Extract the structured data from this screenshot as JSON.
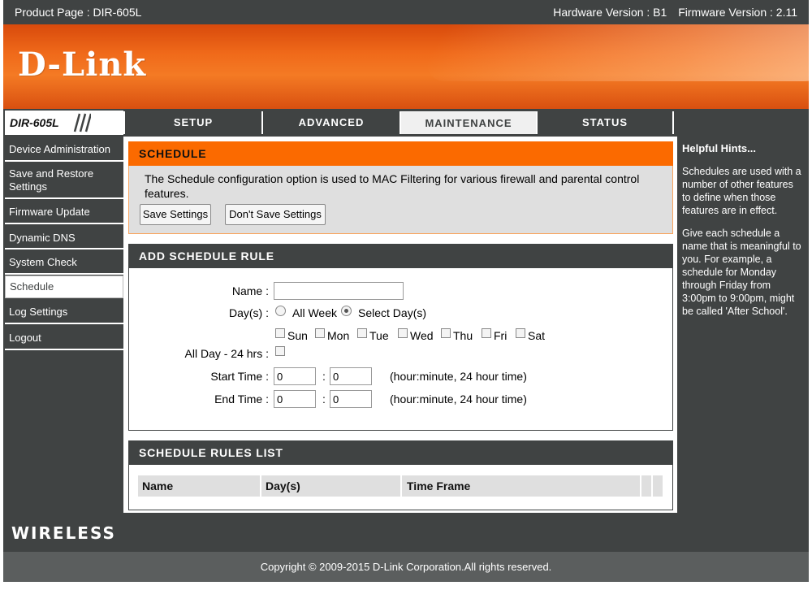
{
  "topbar": {
    "product": "Product Page : DIR-605L",
    "hardware": "Hardware Version : B1",
    "firmware": "Firmware Version : 2.11"
  },
  "brand": {
    "logo": "D-Link",
    "model": "DIR-605L",
    "colors": {
      "orange": "#fb6a00",
      "dark": "#404343"
    }
  },
  "nav": {
    "tabs": [
      {
        "label": "SETUP"
      },
      {
        "label": "ADVANCED"
      },
      {
        "label": "MAINTENANCE",
        "active": true
      },
      {
        "label": "STATUS"
      }
    ]
  },
  "sidebar": {
    "items": [
      {
        "label": "Device Administration"
      },
      {
        "label": "Save and Restore Settings"
      },
      {
        "label": "Firmware Update"
      },
      {
        "label": "Dynamic DNS"
      },
      {
        "label": "System Check"
      },
      {
        "label": "Schedule",
        "active": true
      },
      {
        "label": "Log Settings"
      },
      {
        "label": "Logout"
      }
    ]
  },
  "schedule": {
    "title": "SCHEDULE",
    "description": "The Schedule configuration option is used to MAC Filtering for various firewall and parental control features.",
    "save_label": "Save Settings",
    "dont_save_label": "Don't Save Settings"
  },
  "add_rule": {
    "title": "ADD SCHEDULE RULE",
    "name_label": "Name :",
    "name_value": "",
    "days_label": "Day(s) :",
    "all_week_label": "All Week",
    "select_days_label": "Select Day(s)",
    "days_mode": "Select Day(s)",
    "days": [
      "Sun",
      "Mon",
      "Tue",
      "Wed",
      "Thu",
      "Fri",
      "Sat"
    ],
    "all_day_label": "All Day - 24 hrs :",
    "start_label": "Start Time :",
    "start_hour": "0",
    "start_minute": "0",
    "end_label": "End Time :",
    "end_hour": "0",
    "end_minute": "0",
    "time_sep": ":",
    "time_hint": "(hour:minute, 24 hour time)"
  },
  "rules_list": {
    "title": "SCHEDULE RULES LIST",
    "columns": [
      "Name",
      "Day(s)",
      "Time Frame"
    ]
  },
  "hints": {
    "title": "Helpful Hints...",
    "paragraphs": [
      "Schedules are used with a number of other features to define when those features are in effect.",
      "Give each schedule a name that is meaningful to you. For example, a schedule for Monday through Friday from 3:00pm to 9:00pm, might be called 'After School'."
    ]
  },
  "bottom": {
    "wireless": "WIRELESS",
    "copyright": "Copyright © 2009-2015 D-Link Corporation.All rights reserved."
  }
}
